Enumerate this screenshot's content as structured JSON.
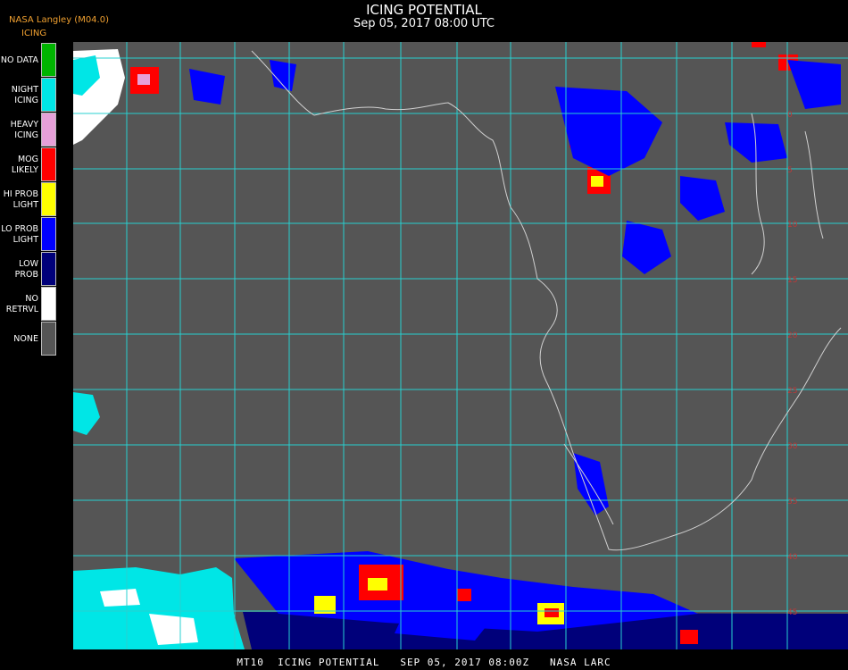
{
  "header": {
    "credit": "NASA Langley (M04.0)",
    "product": "ICING",
    "title": "ICING POTENTIAL",
    "subtitle": "Sep 05, 2017 08:00 UTC"
  },
  "legend": [
    {
      "label": "NO DATA",
      "color": "#00b400"
    },
    {
      "label": "NIGHT\nICING",
      "color": "#00e6e6"
    },
    {
      "label": "HEAVY\nICING",
      "color": "#e6a0d8"
    },
    {
      "label": "MOG\nLIKELY",
      "color": "#ff0000"
    },
    {
      "label": "HI PROB\nLIGHT",
      "color": "#ffff00"
    },
    {
      "label": "LO PROB\nLIGHT",
      "color": "#0000ff"
    },
    {
      "label": "LOW\nPROB",
      "color": "#00007a"
    },
    {
      "label": "NO\nRETRVL",
      "color": "#ffffff"
    },
    {
      "label": "NONE",
      "color": "#555555"
    }
  ],
  "map": {
    "background_color": "#555555",
    "grid_color": "#28d0d0",
    "coastline_color": "#d0d0d0",
    "label_color": "#c03838"
  },
  "footer": "MT10  ICING POTENTIAL   SEP 05, 2017 08:00Z   NASA LARC"
}
